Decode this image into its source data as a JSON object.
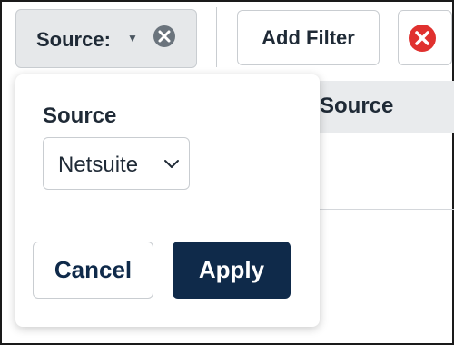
{
  "toolbar": {
    "filter_chip": {
      "label": "Source:",
      "caret_icon": "caret-down-icon",
      "clear_icon": "circle-x-icon"
    },
    "add_filter_label": "Add Filter",
    "remove_icon": "red-circle-x-icon"
  },
  "table": {
    "column_header": "Source"
  },
  "popover": {
    "field_label": "Source",
    "select_value": "Netsuite",
    "cancel_label": "Cancel",
    "apply_label": "Apply"
  },
  "colors": {
    "primary": "#0f2a4a",
    "chip_bg": "#e6e8ea",
    "danger": "#e0312f"
  }
}
